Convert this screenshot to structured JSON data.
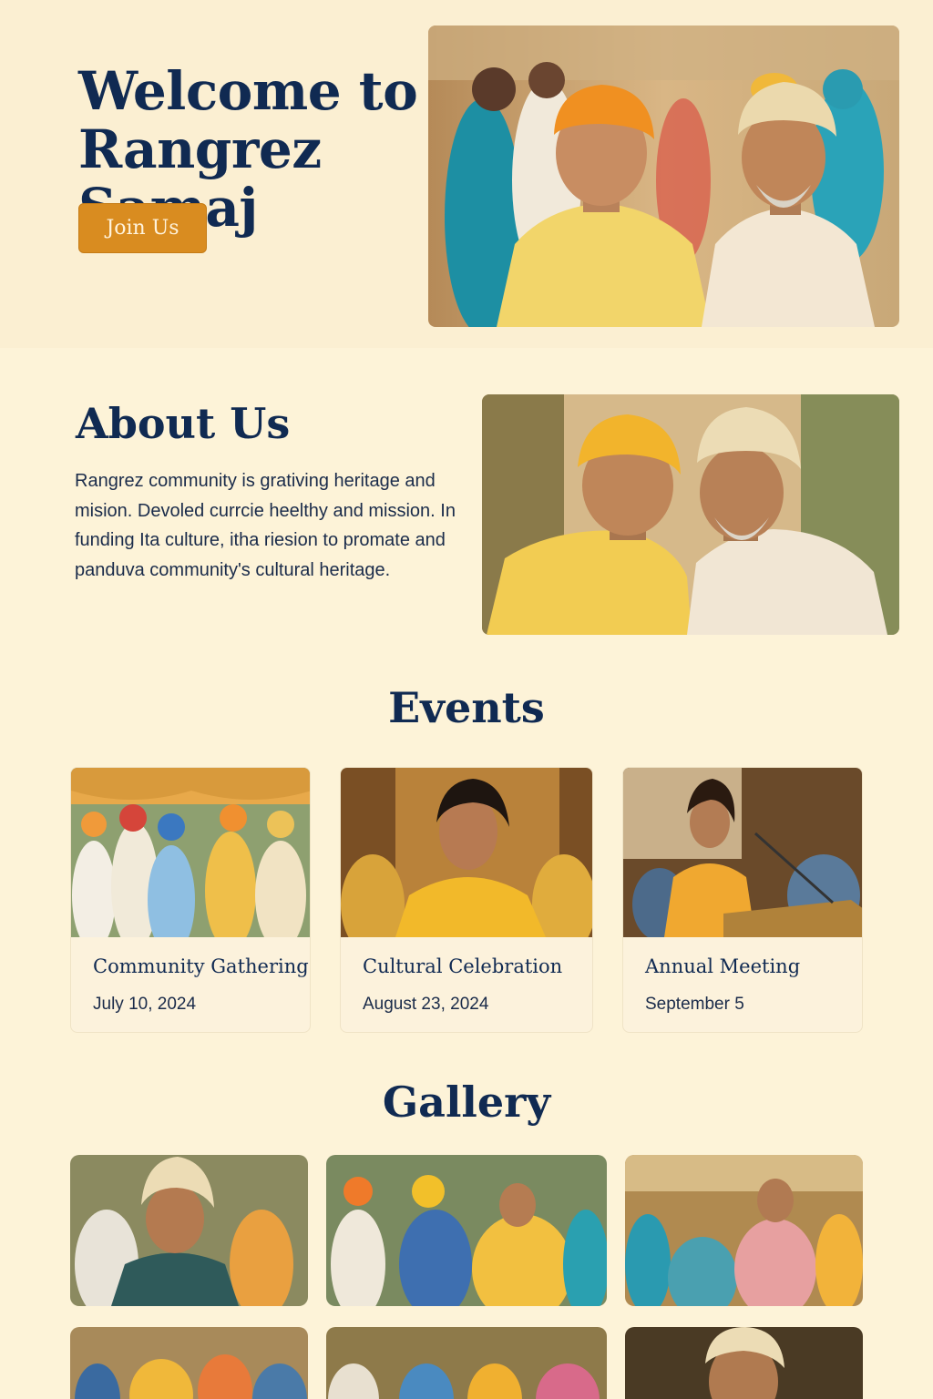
{
  "hero": {
    "title": "Welcome to Rangrez Samaj",
    "cta": "Join Us"
  },
  "about": {
    "title": "About Us",
    "text": "Rangrez community is  grativing heritage and mision. Devoled currcie heelthy and mission. In funding Ita culture, itha riesion to promate and panduva community's cultural heritage."
  },
  "events": {
    "title": "Events",
    "items": [
      {
        "name": "Community Gathering",
        "date": "July 10, 2024"
      },
      {
        "name": "Cultural Celebration",
        "date": "August 23, 2024"
      },
      {
        "name": "Annual Meeting",
        "date": "September 5"
      }
    ]
  },
  "gallery": {
    "title": "Gallery"
  },
  "colors": {
    "background": "#fdf3d8",
    "heading": "#102a52",
    "accent": "#d98c20"
  }
}
